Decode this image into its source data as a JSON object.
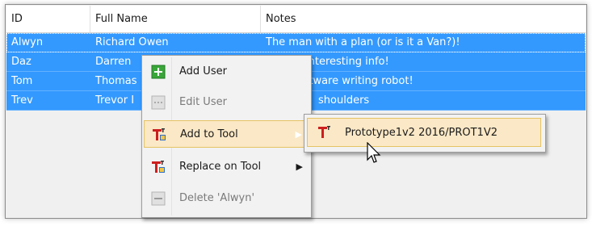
{
  "table": {
    "columns": [
      "ID",
      "Full Name",
      "Notes"
    ],
    "rows": [
      {
        "id": "Alwyn",
        "name": "Richard Owen",
        "notes": "The man with a plan (or is it a Van?)!"
      },
      {
        "id": "Daz",
        "name": "Darren",
        "notes": "interesting info!"
      },
      {
        "id": "Tom",
        "name": "Thomas",
        "notes": "ftware writing robot!"
      },
      {
        "id": "Trev",
        "name": "Trevor I",
        "notes": "shoulders"
      }
    ]
  },
  "context_menu": {
    "items": [
      {
        "label": "Add User",
        "icon": "add-user-icon",
        "enabled": true
      },
      {
        "label": "Edit User",
        "icon": "edit-user-icon",
        "enabled": false
      },
      {
        "label": "Add to Tool",
        "icon": "tool-icon",
        "enabled": true,
        "submenu": true
      },
      {
        "label": "Replace on Tool",
        "icon": "tool-icon",
        "enabled": true,
        "submenu": true
      },
      {
        "label": "Delete 'Alwyn'",
        "icon": "delete-icon",
        "enabled": false
      }
    ],
    "arrow": "▶"
  },
  "submenu": {
    "items": [
      {
        "label": "Prototype1v2 2016/PROT1V2",
        "icon": "tool-icon"
      }
    ]
  },
  "colors": {
    "selection": "#3399ff",
    "highlight": "#fbe8c6",
    "add_green": "#3aa63a",
    "tool_red": "#cc1f1f"
  }
}
